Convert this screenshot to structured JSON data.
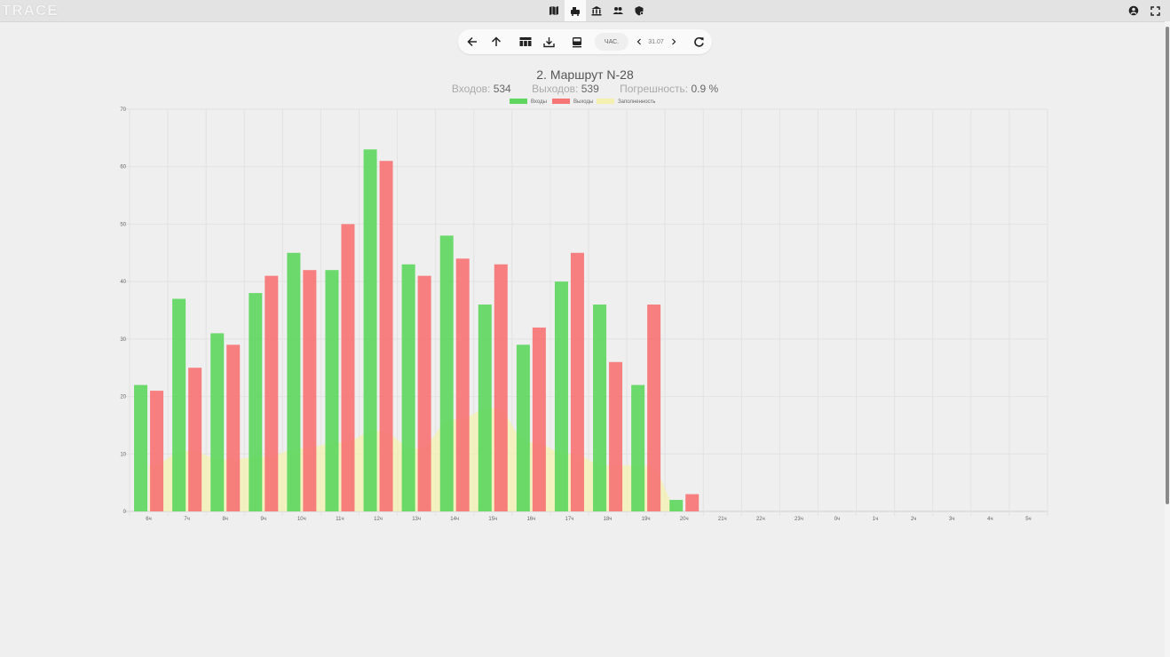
{
  "app": {
    "logo": "TRACE"
  },
  "nav": {
    "icons": [
      "map-icon",
      "bus-icon",
      "bank-icon",
      "people-icon",
      "shield-icon"
    ],
    "active_index": 1,
    "right_icons": [
      "account-icon",
      "fullscreen-icon"
    ]
  },
  "toolbar": {
    "mode_label": "ЧАС.",
    "date": "31.07"
  },
  "header": {
    "title": "2. Маршрут N-28",
    "entries_label": "Входов:",
    "entries_value": "534",
    "exits_label": "Выходов:",
    "exits_value": "539",
    "error_label": "Погрешность:",
    "error_value": "0.9 %"
  },
  "colors": {
    "entries": "#5fd75f",
    "exits": "#f77575",
    "occupancy": "#f4f1b0"
  },
  "chart_data": {
    "type": "bar",
    "categories": [
      "6ч",
      "7ч",
      "8ч",
      "9ч",
      "10ч",
      "11ч",
      "12ч",
      "13ч",
      "14ч",
      "15ч",
      "16ч",
      "17ч",
      "18ч",
      "19ч",
      "20ч",
      "21ч",
      "22ч",
      "23ч",
      "0ч",
      "1ч",
      "2ч",
      "3ч",
      "4ч",
      "5ч"
    ],
    "series": [
      {
        "name": "Входы",
        "type": "bar",
        "values": [
          22,
          37,
          31,
          38,
          45,
          42,
          63,
          43,
          48,
          36,
          29,
          40,
          36,
          22,
          2,
          0,
          0,
          0,
          0,
          0,
          0,
          0,
          0,
          0
        ]
      },
      {
        "name": "Выходы",
        "type": "bar",
        "values": [
          21,
          25,
          29,
          41,
          42,
          50,
          61,
          41,
          44,
          43,
          32,
          45,
          26,
          36,
          3,
          0,
          0,
          0,
          0,
          0,
          0,
          0,
          0,
          0
        ]
      },
      {
        "name": "Заполненность",
        "type": "area",
        "values": [
          8,
          10.5,
          9,
          9.5,
          11,
          12,
          14,
          11,
          16,
          18,
          12,
          10,
          8,
          8,
          0,
          0,
          0,
          0,
          0,
          0,
          0,
          0,
          0,
          0
        ]
      }
    ],
    "ylim": [
      0,
      70
    ],
    "yticks": [
      0,
      10,
      20,
      30,
      40,
      50,
      60,
      70
    ],
    "grid": true,
    "legend": "top-center"
  }
}
